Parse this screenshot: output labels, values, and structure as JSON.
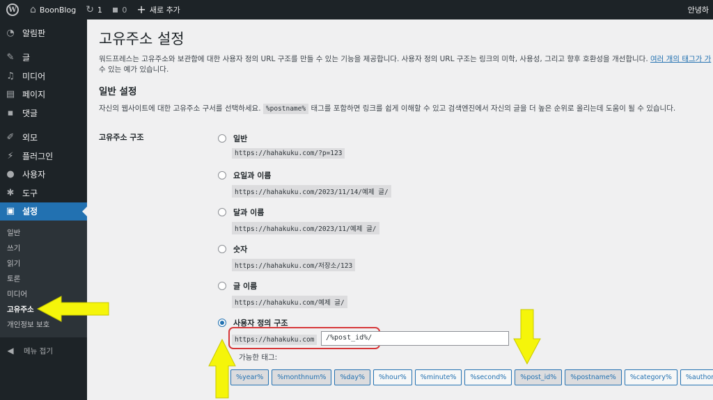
{
  "adminbar": {
    "site_name": "BoonBlog",
    "updates_count": "1",
    "comments_count": "0",
    "new_label": "새로 추가",
    "greeting": "안녕하"
  },
  "sidebar": {
    "items": [
      {
        "icon": "dashboard-icon",
        "label": "알림판"
      },
      {
        "icon": "pin-icon",
        "label": "글"
      },
      {
        "icon": "media-icon",
        "label": "미디어"
      },
      {
        "icon": "page-icon",
        "label": "페이지"
      },
      {
        "icon": "comment-icon",
        "label": "댓글"
      },
      {
        "icon": "appearance-icon",
        "label": "외모"
      },
      {
        "icon": "plugin-icon",
        "label": "플러그인"
      },
      {
        "icon": "user-icon",
        "label": "사용자"
      },
      {
        "icon": "tool-icon",
        "label": "도구"
      },
      {
        "icon": "settings-icon",
        "label": "설정"
      }
    ],
    "submenu": [
      "일반",
      "쓰기",
      "읽기",
      "토론",
      "미디어",
      "고유주소",
      "개인정보 보호"
    ],
    "collapse_label": "메뉴 접기"
  },
  "page": {
    "title": "고유주소 설정",
    "intro": "워드프레스는 고유주소와 보관함에 대한 사용자 정의 URL 구조를 만들 수 있는 기능을 제공합니다. 사용자 정의 URL 구조는 링크의 미학, 사용성, 그리고 향후 호환성을 개선합니다. ",
    "intro_link": "여러 개의 태그가 가",
    "intro_tail": "수 있는 예가 있습니다.",
    "section_title": "일반 설정",
    "desc_before": "자신의 웹사이트에 대한 고유주소 구서를 선택하세요.",
    "desc_code": "%postname%",
    "desc_after": "태그를 포함하면 링크를 쉽게 이해할 수 있고 검색엔진에서 자신의 글을 더 높은 순위로 올리는데 도움이 될 수 있습니다.",
    "row_label": "고유주소 구조"
  },
  "options": [
    {
      "label": "일반",
      "example": "https://hahakuku.com/?p=123"
    },
    {
      "label": "요일과 이름",
      "example": "https://hahakuku.com/2023/11/14/예제 글/"
    },
    {
      "label": "달과 이름",
      "example": "https://hahakuku.com/2023/11/예제 글/"
    },
    {
      "label": "숫자",
      "example": "https://hahakuku.com/저장소/123"
    },
    {
      "label": "글 이름",
      "example": "https://hahakuku.com/예제 글/"
    },
    {
      "label": "사용자 정의 구조",
      "example": ""
    }
  ],
  "custom": {
    "base": "https://hahakuku.com",
    "value": "/%post_id%/",
    "available_label": "가능한 태그:"
  },
  "tags": [
    "%year%",
    "%monthnum%",
    "%day%",
    "%hour%",
    "%minute%",
    "%second%",
    "%post_id%",
    "%postname%",
    "%category%",
    "%author%"
  ],
  "colors": {
    "accent": "#2271b1",
    "sidebar": "#1d2327",
    "highlight": "#d63638",
    "arrow": "#f5f50a"
  }
}
